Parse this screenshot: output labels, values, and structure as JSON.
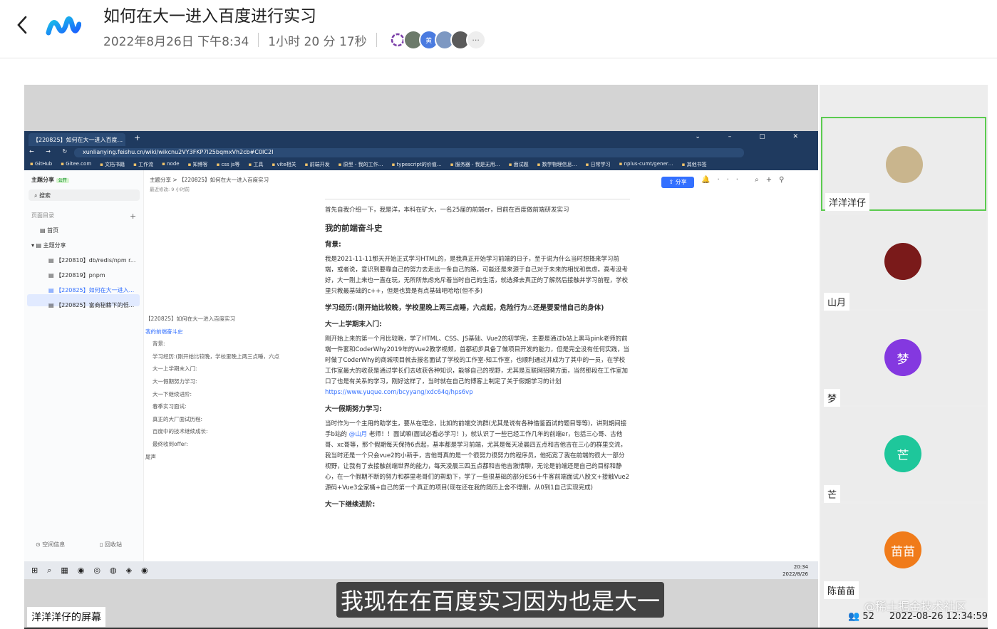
{
  "meeting": {
    "title": "如何在大一进入百度进行实习",
    "date": "2022年8月26日 下午8:34",
    "duration": "1小时 20 分 17秒",
    "avatar_initials": [
      "",
      "黄",
      "",
      "",
      "···"
    ]
  },
  "browser": {
    "tab_title": "【220825】如何在大一进入百度...",
    "url": "xunlianying.feishu.cn/wiki/wikcnu2VY3FKP7l25bqmxVh2cb#C0IC2I",
    "bookmarks": [
      "GitHub",
      "Gitee.com",
      "文档书籍",
      "工作流",
      "node",
      "知博客",
      "css js等",
      "工具",
      "vite相关",
      "前端开发",
      "原型 - 我的工作…",
      "typescript的价值…",
      "服务器 - 我是无用…",
      "面试题",
      "数学物理信息…",
      "日常学习",
      "nplus-cumt/gener…",
      "其他书签"
    ]
  },
  "feishu": {
    "sidebar_title": "主题分享",
    "sidebar_badge": "公开",
    "search_placeholder": "搜索",
    "section": "页面目录",
    "items": [
      "首页",
      "主题分享",
      "【220810】db/redis/npm r...",
      "【220819】pnpm",
      "【220825】如何在大一进入...",
      "【220825】富商秘籍下的低..."
    ],
    "footer": [
      "空间信息",
      "回收站"
    ],
    "breadcrumb": "主题分享  >  【220825】如何在大一进入百度实习",
    "modified": "最近修改: 9 小时前",
    "share": "分享"
  },
  "toc": [
    "【220825】如何在大一进入百度实习",
    "我的前端奋斗史",
    "背景:",
    "学习经历:(刚开始比较晚，学校里晚上两三点睡，六点",
    "大一上学期末入门:",
    "大一假期努力学习:",
    "大一下继续进阶:",
    "春季实习面试:",
    "真正的大厂面试历程:",
    "百度中的技术继续成长:",
    "最终收到offer:",
    "尾声"
  ],
  "doc": {
    "intro": "首先自我介绍一下，我是洋，本科在矿大，一名25届的前端er，目前在百度做前端研发实习",
    "h1": "我的前端奋斗史",
    "bg_title": "背景:",
    "bg_text": "我是2021-11-11那天开始正式学习HTML的，是我真正开始学习前端的日子，至于说为什么当时想择来学习前端，或者说，意识到要靠自己的努力去走出一条自己的路，可能还是来源于自己对于未来的相忧和焦虑。高考没考好，大一刚上来也一直在玩，无所所焦虑充斥着当时自己的生活，就选择去真正的了解然后接触并学习前程，学校里只教最基础的c++，但是也算是有点基础吧哈哈(但不多)",
    "exp_title": "学习经历:(刚开始比较晚，学校里晚上两三点睡，六点起，危险行为⚠还是要爱惜自己的身体)",
    "h_term": "大一上学期末入门:",
    "term_text": "刚开始上来的第一个月比较晚，学了HTML、CSS、JS基础、Vue2的初学完，主要是通过b站上黑马pink老师的前端一件套和CoderWhy2019年的Vue2教学视频，首都初步具备了做项目开发的能力，但是完全没有任何实践，当时做了CoderWhy的商城项目就去报名面试了学校的工作室-知工作室，也顺利通过并成为了其中的一员，在学校工作室最大的收获是通过学长们去收获各种知识，能够自己的视野，尤其是互联网招聘方面，当然那段在工作室加口了也是有关系的学习，刚好这样了，当时就在自己的博客上制定了关于假期学习的计划",
    "term_link": "https://www.yuque.com/bcyyang/xdc64q/hps6vp",
    "h_vac": "大一假期努力学习:",
    "vac_text": "当时作为一个主用的助学生，要从在理念，比如的前端交流群(尤其是说有各种借鉴面试的题目等等)，讲到期间接手b站的",
    "vac_mention": "@山月",
    "vac_text2": "老师！！面试嘛(面试必看必学习！)，就认识了一些已经工作几年的前端er，包括三心哥、古他哥、xc哥等，那个假期每天保持6点起，基本都是学习前端，尤其是每天凌晨四五点和吉他吉在三心的群里交流，我当时还是一个只会vue2的小新手，吉他哥真的是一个很努力很努力的程序员，他拓宽了我在前端的很大一部分视野，让我有了去接触前端世界的能力，每天凌晨三四五点都和吉他吉激情聊，无论是前端还是自己的目标和静心，在一个假期不断的努力和群里老哥们的帮助下，学了一些很基础的部分ES6十牛客前端面试八股文+接触Vue2源码+Vue3全家桶+自己的第一个真正的项目(现在还在我的简历上舍不得删，从0到1自己实现完成)",
    "h_next": "大一下继续进阶:"
  },
  "taskbar": {
    "time": "20:34",
    "date": "2022/8/26"
  },
  "screen_label": "洋洋洋仔的屏幕",
  "subtitle": "我现在在百度实习因为也是大一",
  "participants": [
    {
      "name": "洋洋洋仔",
      "avatar": "",
      "color": "#c9b58d",
      "active": true
    },
    {
      "name": "山月",
      "avatar": "",
      "color": "#7a1a1a",
      "active": false
    },
    {
      "name": "梦",
      "avatar": "梦",
      "color": "#8438e0",
      "active": false
    },
    {
      "name": "芒",
      "avatar": "芒",
      "color": "#1ec79b",
      "active": false
    },
    {
      "name": "陈苗苗",
      "avatar": "苗苗",
      "color": "#f07b1a",
      "active": false
    }
  ],
  "viewer_count": "52",
  "timestamp": "2022-08-26 12:34:59",
  "watermark": "@稀土掘金技术社区"
}
